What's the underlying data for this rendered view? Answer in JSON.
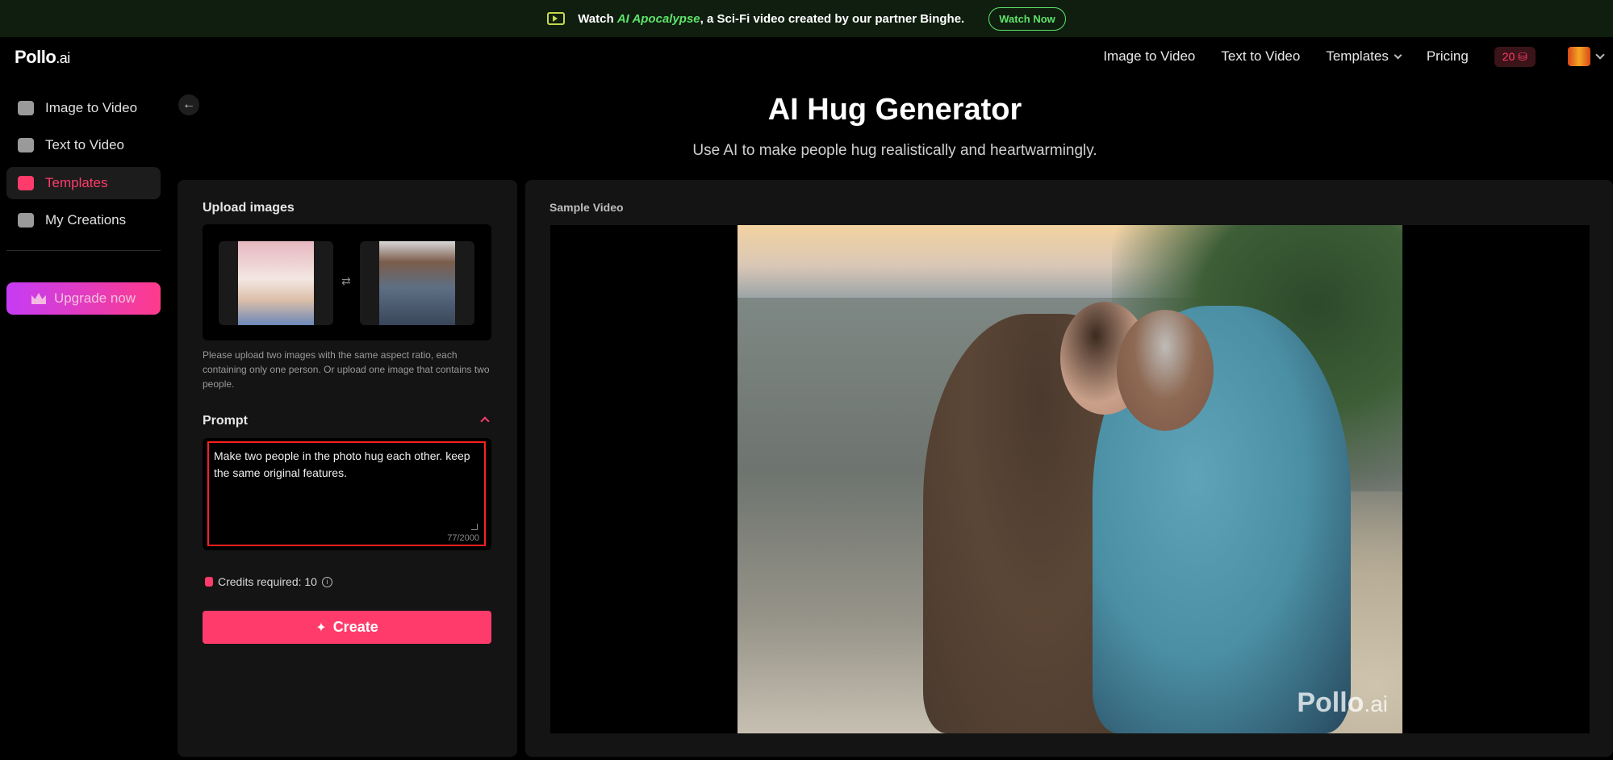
{
  "banner": {
    "prefix": "Watch",
    "highlight": "AI Apocalypse",
    "suffix": ", a Sci-Fi video created by our partner Binghe.",
    "button": "Watch Now"
  },
  "header": {
    "logo_main": "Pollo",
    "logo_sub": ".ai",
    "nav": [
      "Image to Video",
      "Text to Video",
      "Templates",
      "Pricing"
    ],
    "credits": "20 ⛁"
  },
  "sidebar": {
    "items": [
      {
        "label": "Image to Video",
        "icon": "image-video-icon"
      },
      {
        "label": "Text to Video",
        "icon": "text-video-icon"
      },
      {
        "label": "Templates",
        "icon": "templates-icon",
        "active": true
      },
      {
        "label": "My Creations",
        "icon": "creations-icon"
      }
    ],
    "upgrade": "Upgrade now"
  },
  "main": {
    "title": "AI Hug Generator",
    "subtitle": "Use AI to make people hug realistically and heartwarmingly."
  },
  "left_panel": {
    "upload_title": "Upload images",
    "hint": "Please upload two images with the same aspect ratio, each containing only one person. Or upload one image that contains two people.",
    "prompt_label": "Prompt",
    "prompt_value": "Make two people in the photo hug each other. keep the same original features.",
    "counter": "77/2000",
    "credits_text": "Credits required: 10",
    "create": "Create"
  },
  "right_panel": {
    "title": "Sample Video",
    "watermark_main": "Pollo",
    "watermark_sub": ".ai"
  },
  "colors": {
    "accent": "#ff3b6b",
    "banner_green": "#5fe36a",
    "panel_bg": "#141414"
  }
}
